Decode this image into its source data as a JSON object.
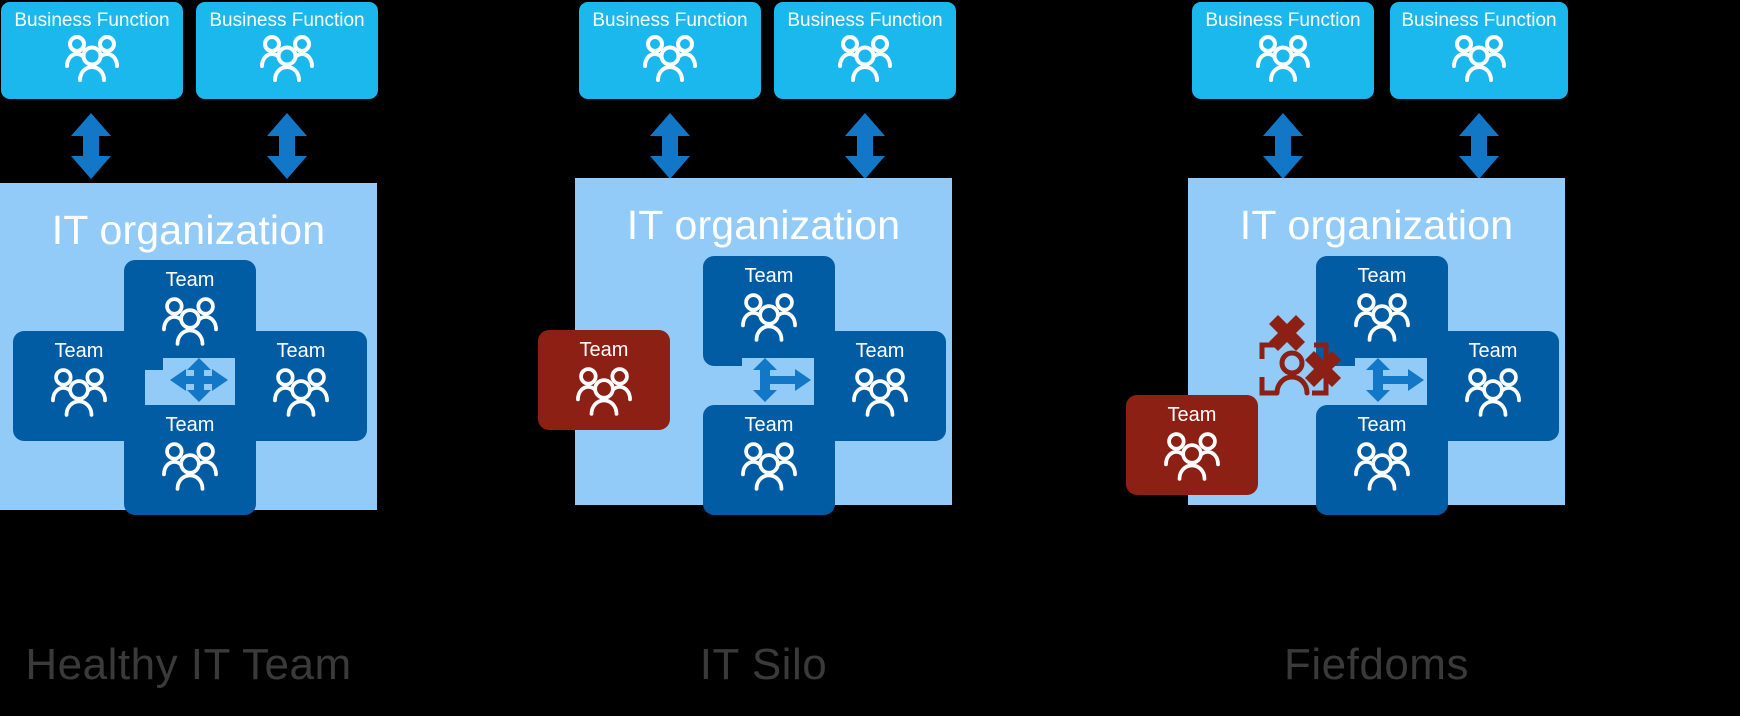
{
  "diagram": {
    "background_color": "#000000",
    "caption_color": "#3A3A3A",
    "colors": {
      "business_function": "#1BB8EE",
      "it_org": "#92CBF7",
      "team": "#015CA4",
      "team_conflict": "#8D2015",
      "arrow": "#1277C6",
      "text_light": "#FFFFFF"
    }
  },
  "panels": [
    {
      "id": "healthy",
      "caption": "Healthy IT Team",
      "it_org_title": "IT organization",
      "business_functions": [
        {
          "label": "Business Function",
          "icon": "people-group-icon"
        },
        {
          "label": "Business Function",
          "icon": "people-group-icon"
        }
      ],
      "connector_icons": [
        "double-arrow-vertical-icon",
        "double-arrow-vertical-icon"
      ],
      "teams": [
        {
          "label": "Team",
          "position": "top",
          "state": "aligned",
          "icon": "people-group-icon"
        },
        {
          "label": "Team",
          "position": "left",
          "state": "aligned",
          "icon": "people-group-icon"
        },
        {
          "label": "Team",
          "position": "right",
          "state": "aligned",
          "icon": "people-group-icon"
        },
        {
          "label": "Team",
          "position": "bottom",
          "state": "aligned",
          "icon": "people-group-icon"
        }
      ],
      "hub_icon": "four-way-arrow-icon",
      "conflict_icon": null
    },
    {
      "id": "silo",
      "caption": "IT Silo",
      "it_org_title": "IT organization",
      "business_functions": [
        {
          "label": "Business Function",
          "icon": "people-group-icon"
        },
        {
          "label": "Business Function",
          "icon": "people-group-icon"
        }
      ],
      "connector_icons": [
        "double-arrow-vertical-icon",
        "double-arrow-vertical-icon"
      ],
      "teams": [
        {
          "label": "Team",
          "position": "top",
          "state": "aligned",
          "icon": "people-group-icon"
        },
        {
          "label": "Team",
          "position": "left",
          "state": "isolated",
          "icon": "people-group-icon"
        },
        {
          "label": "Team",
          "position": "right",
          "state": "aligned",
          "icon": "people-group-icon"
        },
        {
          "label": "Team",
          "position": "bottom",
          "state": "aligned",
          "icon": "people-group-icon"
        }
      ],
      "hub_icon": "three-way-arrow-icon",
      "conflict_icon": null
    },
    {
      "id": "fiefdoms",
      "caption": "Fiefdoms",
      "it_org_title": "IT organization",
      "business_functions": [
        {
          "label": "Business Function",
          "icon": "people-group-icon"
        },
        {
          "label": "Business Function",
          "icon": "people-group-icon"
        }
      ],
      "connector_icons": [
        "double-arrow-vertical-icon",
        "double-arrow-vertical-icon"
      ],
      "teams": [
        {
          "label": "Team",
          "position": "top",
          "state": "aligned",
          "icon": "people-group-icon"
        },
        {
          "label": "Team",
          "position": "left",
          "state": "isolated",
          "icon": "people-group-icon"
        },
        {
          "label": "Team",
          "position": "right",
          "state": "aligned",
          "icon": "people-group-icon"
        },
        {
          "label": "Team",
          "position": "bottom",
          "state": "aligned",
          "icon": "people-group-icon"
        }
      ],
      "hub_icon": "three-way-arrow-icon",
      "conflict_icon": "blocked-person-icon"
    }
  ]
}
